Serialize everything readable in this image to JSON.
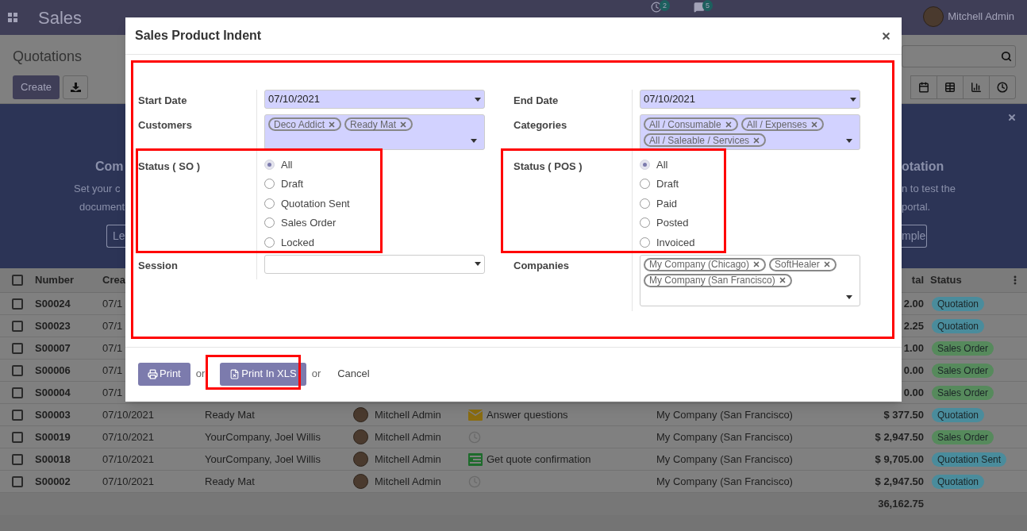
{
  "navbar": {
    "app_name": "Sales",
    "activity_count": "2",
    "message_count": "5",
    "user": "Mitchell Admin"
  },
  "control_panel": {
    "title": "Quotations",
    "create_button": "Create"
  },
  "banner": {
    "left_title": "Com",
    "left_lines": [
      "Set your c",
      "document"
    ],
    "left_button": "Le",
    "right_title": "otation",
    "right_lines": [
      "n to test the",
      "portal."
    ],
    "right_button": "mple"
  },
  "table": {
    "columns": [
      "Number",
      "Crea",
      "tal",
      "Status"
    ],
    "select_all": {
      "checked": false
    },
    "rows": [
      {
        "checked": false,
        "number": "S00024",
        "created": "07/1",
        "total": "2.00",
        "status": "Quotation",
        "color": "#4a8c9c"
      },
      {
        "checked": false,
        "number": "S00023",
        "created": "07/1",
        "total": "2.25",
        "status": "Quotation",
        "color": "#4a8c9c"
      },
      {
        "checked": false,
        "number": "S00007",
        "created": "07/1",
        "total": "1.00",
        "status": "Sales Order",
        "color": "#568a5c"
      },
      {
        "checked": false,
        "number": "S00006",
        "created": "07/1",
        "total": "0.00",
        "status": "Sales Order",
        "color": "#568a5c"
      },
      {
        "checked": false,
        "number": "S00004",
        "created": "07/1",
        "total": "0.00",
        "status": "Sales Order",
        "color": "#568a5c"
      },
      {
        "checked": false,
        "number": "S00003",
        "created": "07/10/2021",
        "customer": "Ready Mat",
        "salesperson": "Mitchell Admin",
        "activity": {
          "kind": "email",
          "text": "Answer questions"
        },
        "company": "My Company (San Francisco)",
        "total": "$ 377.50",
        "status": "Quotation",
        "color": "#4a8c9c"
      },
      {
        "checked": false,
        "number": "S00019",
        "created": "07/10/2021",
        "customer": "YourCompany, Joel Willis",
        "salesperson": "Mitchell Admin",
        "activity": {
          "kind": "none"
        },
        "company": "My Company (San Francisco)",
        "total": "$ 2,947.50",
        "status": "Sales Order",
        "color": "#568a5c"
      },
      {
        "checked": false,
        "number": "S00018",
        "created": "07/10/2021",
        "customer": "YourCompany, Joel Willis",
        "salesperson": "Mitchell Admin",
        "activity": {
          "kind": "todo",
          "text": "Get quote confirmation"
        },
        "company": "My Company (San Francisco)",
        "total": "$ 9,705.00",
        "status": "Quotation Sent",
        "color": "#4a8c9c"
      },
      {
        "checked": false,
        "number": "S00002",
        "created": "07/10/2021",
        "customer": "Ready Mat",
        "salesperson": "Mitchell Admin",
        "activity": {
          "kind": "none"
        },
        "company": "My Company (San Francisco)",
        "total": "$ 2,947.50",
        "status": "Quotation",
        "color": "#4a8c9c"
      }
    ],
    "sum": "36,162.75"
  },
  "dialog": {
    "title": "Sales Product Indent",
    "columns": [
      {
        "fields": [
          {
            "kind": "date",
            "label": "Start Date",
            "value": "07/10/2021",
            "required": true
          },
          {
            "kind": "tags",
            "label": "Customers",
            "tags": [
              "Deco Addict",
              "Ready Mat"
            ],
            "required": true
          },
          {
            "kind": "radio",
            "label": "Status ( SO )",
            "options": [
              {
                "label": "All",
                "selected": true
              },
              {
                "label": "Draft",
                "selected": false
              },
              {
                "label": "Quotation Sent",
                "selected": false
              },
              {
                "label": "Sales Order",
                "selected": false
              },
              {
                "label": "Locked",
                "selected": false
              }
            ]
          },
          {
            "kind": "date",
            "label": "Session",
            "required": false
          }
        ]
      },
      {
        "fields": [
          {
            "kind": "date",
            "label": "End Date",
            "value": "07/10/2021",
            "required": true
          },
          {
            "kind": "tags",
            "label": "Categories",
            "tags": [
              "All / Consumable",
              "All / Expenses",
              "All / Saleable / Services"
            ],
            "required": true
          },
          {
            "kind": "radio",
            "label": "Status ( POS )",
            "options": [
              {
                "label": "All",
                "selected": true
              },
              {
                "label": "Draft",
                "selected": false
              },
              {
                "label": "Paid",
                "selected": false
              },
              {
                "label": "Posted",
                "selected": false
              },
              {
                "label": "Invoiced",
                "selected": false
              }
            ]
          },
          {
            "kind": "tags",
            "label": "Companies",
            "tags": [
              "My Company (Chicago)",
              "SoftHealer",
              "My Company (San Francisco)"
            ],
            "required": false
          }
        ]
      }
    ],
    "footer": [
      {
        "kind": "button",
        "label": "Print"
      },
      {
        "kind": "text",
        "label": "or"
      },
      {
        "kind": "button",
        "label": "Print In XLS"
      },
      {
        "kind": "text",
        "label": "or"
      },
      {
        "kind": "link",
        "label": "Cancel"
      }
    ]
  }
}
